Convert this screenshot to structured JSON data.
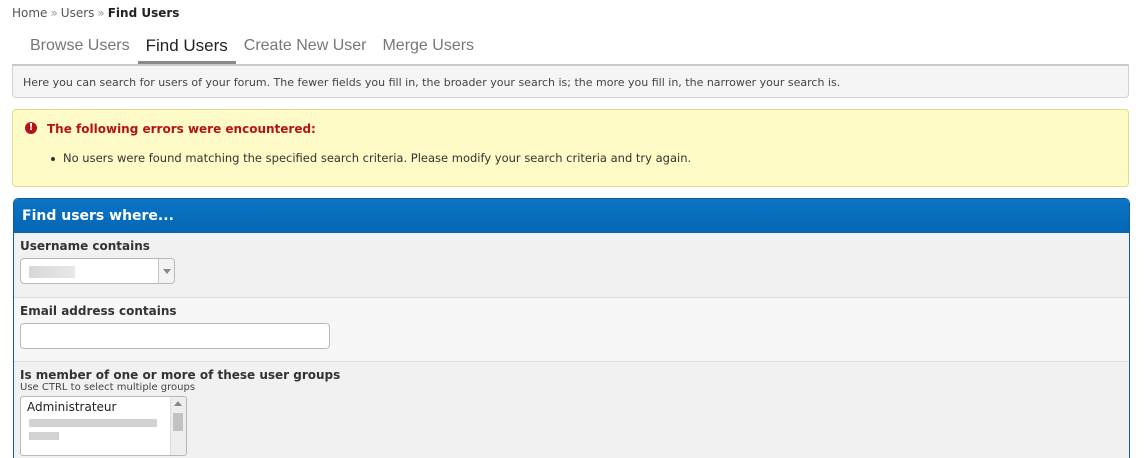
{
  "breadcrumb": {
    "items": [
      "Home",
      "Users"
    ],
    "separator": "»",
    "current": "Find Users"
  },
  "tabs": [
    {
      "label": "Browse Users",
      "active": false
    },
    {
      "label": "Find Users",
      "active": true
    },
    {
      "label": "Create New User",
      "active": false
    },
    {
      "label": "Merge Users",
      "active": false
    }
  ],
  "description": "Here you can search for users of your forum. The fewer fields you fill in, the broader your search is; the more you fill in, the narrower your search is.",
  "error": {
    "icon": "exclamation-icon",
    "title": "The following errors were encountered:",
    "messages": [
      "No users were found matching the specified search criteria. Please modify your search criteria and try again."
    ]
  },
  "form": {
    "header": "Find users where...",
    "username": {
      "label": "Username contains",
      "value": ""
    },
    "email": {
      "label": "Email address contains",
      "value": "",
      "placeholder": ""
    },
    "groups": {
      "label": "Is member of one or more of these user groups",
      "hint": "Use CTRL to select multiple groups",
      "options": [
        "Administrateur"
      ]
    }
  },
  "colors": {
    "header_blue": "#0566b3",
    "error_red": "#b3141a",
    "error_bg": "#fefbc7"
  }
}
